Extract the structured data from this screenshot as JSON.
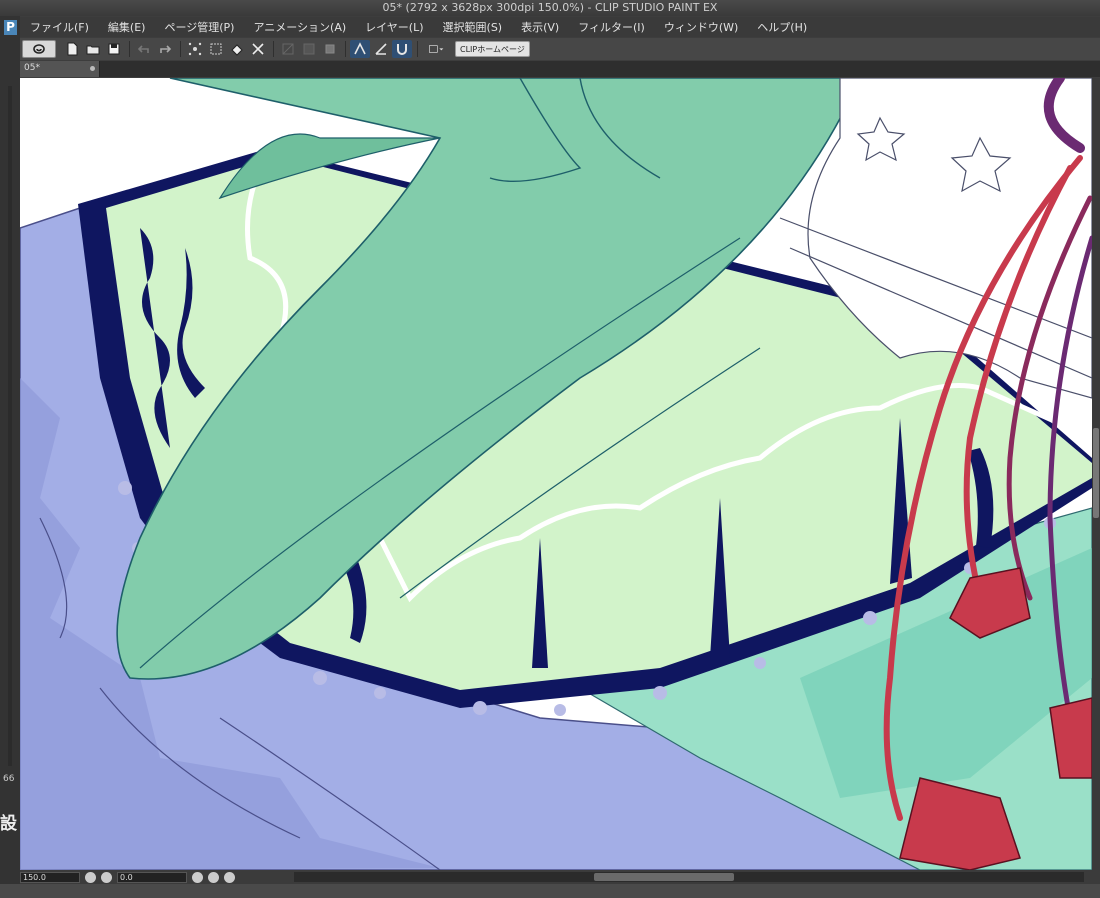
{
  "window": {
    "title": "05* (2792 x 3628px 300dpi 150.0%)  - CLIP STUDIO PAINT EX"
  },
  "menu": [
    {
      "label": "ファイル(F)"
    },
    {
      "label": "編集(E)"
    },
    {
      "label": "ページ管理(P)"
    },
    {
      "label": "アニメーション(A)"
    },
    {
      "label": "レイヤー(L)"
    },
    {
      "label": "選択範囲(S)"
    },
    {
      "label": "表示(V)"
    },
    {
      "label": "フィルター(I)"
    },
    {
      "label": "ウィンドウ(W)"
    },
    {
      "label": "ヘルプ(H)"
    }
  ],
  "toolbar": {
    "home_button": "CLIPホームページ"
  },
  "left_panel": {
    "logo_letter": "P",
    "value": "66",
    "label_char": "設"
  },
  "document": {
    "tab_name": "05*"
  },
  "status": {
    "zoom": "150.0",
    "rotation": "0.0"
  },
  "colors": {
    "hat_green": "#82ccab",
    "lace_light": "#d2f3ca",
    "navy": "#0f1660",
    "skirt_lavender": "#a3aee6",
    "cord_red": "#c83a4c",
    "cord_purple": "#6b2a72"
  }
}
